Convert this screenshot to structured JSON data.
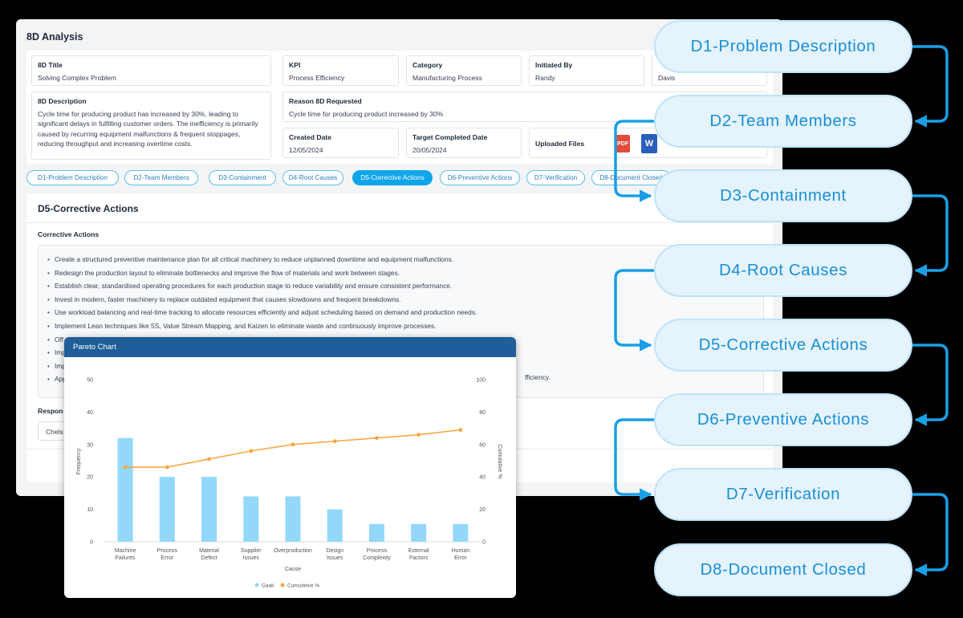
{
  "app": {
    "title": "8D Analysis"
  },
  "fields": {
    "title": {
      "label": "8D Title",
      "value": "Solving Complex Problem"
    },
    "kpi": {
      "label": "KPI",
      "value": "Process Efficiency"
    },
    "category": {
      "label": "Category",
      "value": "Manufacturing Process"
    },
    "initiated_by": {
      "label": "Initiated By",
      "value": "Randy"
    },
    "extra_value": "Davis",
    "description": {
      "label": "8D Description",
      "value": "Cycle time for producing product has increased by 30%, leading to significant delays in fulfilling customer orders. The inefficiency is primarily caused by recurring equipment malfunctions & frequent stoppages, reducing throughput and increasing overtime costs."
    },
    "reason": {
      "label": "Reason 8D Requested",
      "value": "Cycle time for producing product increased by 30%"
    },
    "created_date": {
      "label": "Created Date",
      "value": "12/05/2024"
    },
    "target_date": {
      "label": "Target Completed Date",
      "value": "20/05/2024"
    },
    "uploaded_files": {
      "label": "Uploaded Files",
      "pdf_badge": "PDF",
      "word_badge": "W"
    }
  },
  "tabs": [
    {
      "label": "D1-Problem Description",
      "active": false
    },
    {
      "label": "D2-Team Members",
      "active": false
    },
    {
      "label": "D3-Containment",
      "active": false
    },
    {
      "label": "D4-Root Causes",
      "active": false
    },
    {
      "label": "D5-Corrective Actions",
      "active": true
    },
    {
      "label": "D6-Preventive Actions",
      "active": false
    },
    {
      "label": "D7-Verification",
      "active": false
    },
    {
      "label": "D8-Document Closed",
      "active": false
    }
  ],
  "section": {
    "title": "D5-Corrective Actions",
    "subtitle": "Corrective Actions",
    "actions": [
      "Create a structured preventive maintenance plan for all critical machinery to reduce unplanned downtime and equipment malfunctions.",
      "Redesign the production layout to eliminate bottlenecks and improve the flow of materials and work between stages.",
      "Establish clear, standardised operating procedures for each production stage to reduce variability and ensure consistent performance.",
      "Invest in modern, faster machinery to replace outdated equipment that causes slowdowns and frequent breakdowns.",
      "Use workload balancing and real-time tracking to allocate resources efficiently and adjust scheduling based on demand and production needs.",
      "Implement Lean techniques like 5S, Value Stream Mapping, and Kaizen to eliminate waste and continuously improve processes.",
      "Off",
      "Imp",
      "Imp",
      "App"
    ],
    "trailing_text": "fficiency.",
    "responsible_label": "Respon",
    "responsible_value": "Chels"
  },
  "pareto": {
    "header": "Pareto Chart"
  },
  "chart_data": {
    "type": "bar",
    "title": "Pareto Chart",
    "categories": [
      [
        "Machine",
        "Failures"
      ],
      [
        "Process",
        "Error"
      ],
      [
        "Material",
        "Defect"
      ],
      [
        "Supplier",
        "Issues"
      ],
      [
        "Overproduction"
      ],
      [
        "Design",
        "Issues"
      ],
      [
        "Process",
        "Complexity"
      ],
      [
        "External",
        "Factors"
      ],
      [
        "Human",
        "Error"
      ]
    ],
    "series": [
      {
        "name": "Gaali",
        "kind": "bar",
        "axis": "left",
        "values": [
          32,
          20,
          20,
          14,
          14,
          10,
          5.5,
          5.5,
          5.5
        ],
        "color": "#93d8fa"
      },
      {
        "name": "Cumulative %",
        "kind": "line",
        "axis": "right",
        "values": [
          46,
          46,
          51,
          56,
          60,
          62,
          64,
          66,
          69
        ],
        "color": "#f5a742"
      }
    ],
    "xlabel": "Cause",
    "ylabel": "Frequency",
    "y2label": "Cumulative %",
    "ylim": [
      0,
      50
    ],
    "y2lim": [
      0,
      100
    ],
    "yticks": [
      0,
      10,
      20,
      30,
      40,
      50
    ],
    "y2ticks": [
      0,
      20,
      40,
      60,
      80,
      100
    ],
    "grid": false,
    "legend": "bottom"
  },
  "flow": {
    "steps": [
      "D1-Problem Description",
      "D2-Team Members",
      "D3-Containment",
      "D4-Root Causes",
      "D5-Corrective Actions",
      "D6-Preventive Actions",
      "D7-Verification",
      "D8-Document Closed"
    ],
    "accent": "#1a9fe6"
  },
  "colors": {
    "tab_active": "#0ea5e9",
    "pareto_header": "#1f5e99",
    "pdf_icon": "#e34b3c",
    "word_icon": "#2b5fbd"
  }
}
